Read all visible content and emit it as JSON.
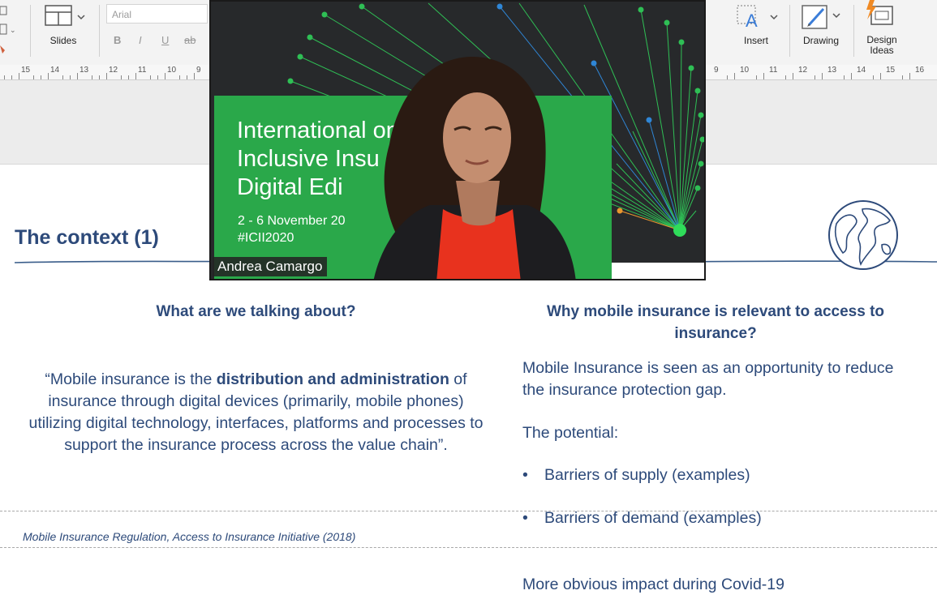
{
  "ribbon": {
    "slides_label": "Slides",
    "font_name": "Arial",
    "format_buttons": [
      "B",
      "I",
      "U",
      "ab"
    ],
    "insert_label": "Insert",
    "drawing_label": "Drawing",
    "design_ideas_label": "Design\nIdeas"
  },
  "ruler": {
    "left_numbers": [
      "15",
      "14",
      "13",
      "12",
      "11",
      "10",
      "9"
    ],
    "right_numbers": [
      "9",
      "10",
      "11",
      "12",
      "13",
      "14",
      "15",
      "16"
    ]
  },
  "slide": {
    "title": "The context (1)",
    "left_heading": "What are we talking about?",
    "quote_pre": "“Mobile insurance is the ",
    "quote_bold": "distribution and administration",
    "quote_post": " of insurance through digital devices (primarily, mobile phones) utilizing digital technology, interfaces, platforms and processes to support the insurance process across the value chain”.",
    "citation": "Mobile Insurance Regulation, Access to Insurance Initiative (2018)",
    "right_heading": "Why mobile insurance is relevant to access to insurance?",
    "right_intro": "Mobile Insurance is seen as an opportunity to reduce the insurance protection gap.",
    "potential_label": "The potential:",
    "bullets": [
      "Barriers of supply (examples)",
      "Barriers of demand (examples)"
    ],
    "covid_text": "More obvious impact during Covid-19"
  },
  "video": {
    "title_text": "International          on\nInclusive Insu\nDigital Edi",
    "dates": "2 - 6 November 20",
    "hashtag": "#ICII2020",
    "speaker_name": "Andrea Camargo"
  },
  "colors": {
    "title_blue": "#2d4a7a",
    "banner_green": "#2aa84a",
    "shirt_red": "#e8321e"
  }
}
